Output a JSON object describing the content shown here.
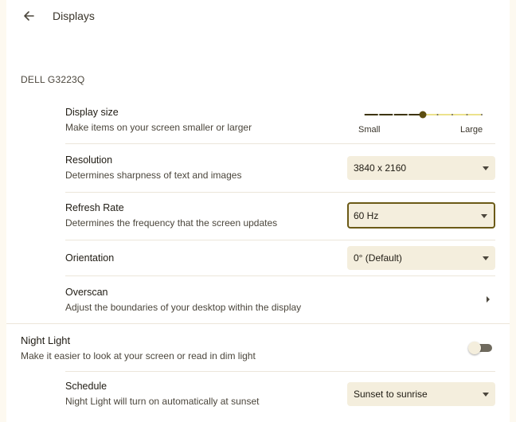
{
  "header": {
    "title": "Displays"
  },
  "monitor": {
    "name": "DELL G3223Q"
  },
  "display_size": {
    "title": "Display size",
    "subtitle": "Make items on your screen smaller or larger",
    "min_label": "Small",
    "max_label": "Large",
    "level_fraction": 0.5,
    "steps": 9
  },
  "resolution": {
    "title": "Resolution",
    "subtitle": "Determines sharpness of text and images",
    "value": "3840 x 2160"
  },
  "refresh_rate": {
    "title": "Refresh Rate",
    "subtitle": "Determines the frequency that the screen updates",
    "value": "60 Hz"
  },
  "orientation": {
    "title": "Orientation",
    "value": "0° (Default)"
  },
  "overscan": {
    "title": "Overscan",
    "subtitle": "Adjust the boundaries of your desktop within the display"
  },
  "night_light": {
    "title": "Night Light",
    "subtitle": "Make it easier to look at your screen or read in dim light",
    "enabled": false
  },
  "schedule": {
    "title": "Schedule",
    "subtitle": "Night Light will turn on automatically at sunset",
    "value": "Sunset to sunrise"
  },
  "colors": {
    "accent": "#6b5a16",
    "select_bg": "#f4eedd",
    "background": "#fdf9f0"
  }
}
